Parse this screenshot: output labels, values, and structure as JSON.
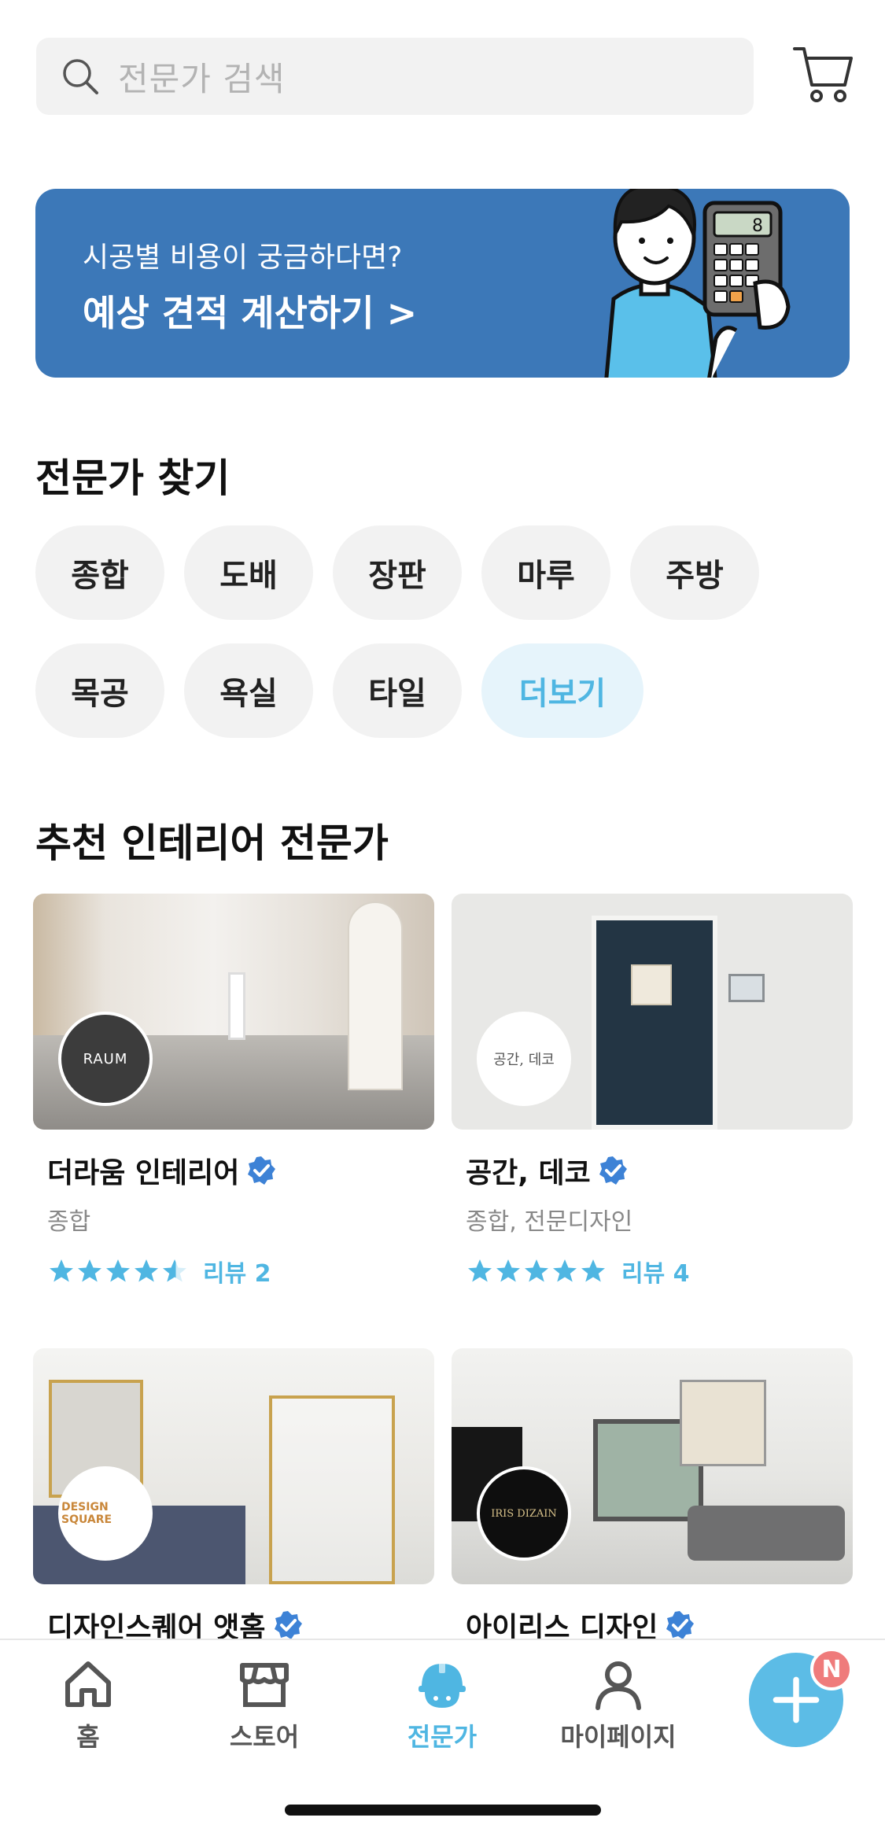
{
  "search": {
    "placeholder": "전문가 검색"
  },
  "banner": {
    "subtitle": "시공별 비용이 궁금하다면?",
    "title": "예상 견적 계산하기 >",
    "calculator_display": "8"
  },
  "find_experts": {
    "title": "전문가 찾기",
    "chips_row1": [
      "종합",
      "도배",
      "장판",
      "마루",
      "주방"
    ],
    "chips_row2": [
      "목공",
      "욕실",
      "타일"
    ],
    "more_label": "더보기"
  },
  "recommended": {
    "title": "추천 인테리어 전문가",
    "cards": [
      {
        "name": "더라움 인테리어",
        "category": "종합",
        "review": "리뷰 2",
        "rating": 4.5,
        "logo_text": "RAUM"
      },
      {
        "name": "공간, 데코",
        "category": "종합, 전문디자인",
        "review": "리뷰 4",
        "rating": 5,
        "logo_text": "공간, 데코"
      },
      {
        "name": "디자인스퀘어 앳홈",
        "category": "",
        "review": "",
        "rating": null,
        "logo_text": "DESIGN SQUARE"
      },
      {
        "name": "아이리스 디자인",
        "category": "",
        "review": "",
        "rating": null,
        "logo_text": "IRIS DIZAIN"
      }
    ]
  },
  "tabbar": {
    "tabs": [
      {
        "label": "홈",
        "icon": "home-icon"
      },
      {
        "label": "스토어",
        "icon": "store-icon"
      },
      {
        "label": "전문가",
        "icon": "expert-helmet-icon",
        "active": true
      },
      {
        "label": "마이페이지",
        "icon": "person-icon"
      }
    ],
    "fab_badge": "N"
  },
  "colors": {
    "accent": "#4fb6e2",
    "banner": "#3c78b8",
    "badge": "#ef7b7b",
    "verified": "#3d82d6"
  }
}
